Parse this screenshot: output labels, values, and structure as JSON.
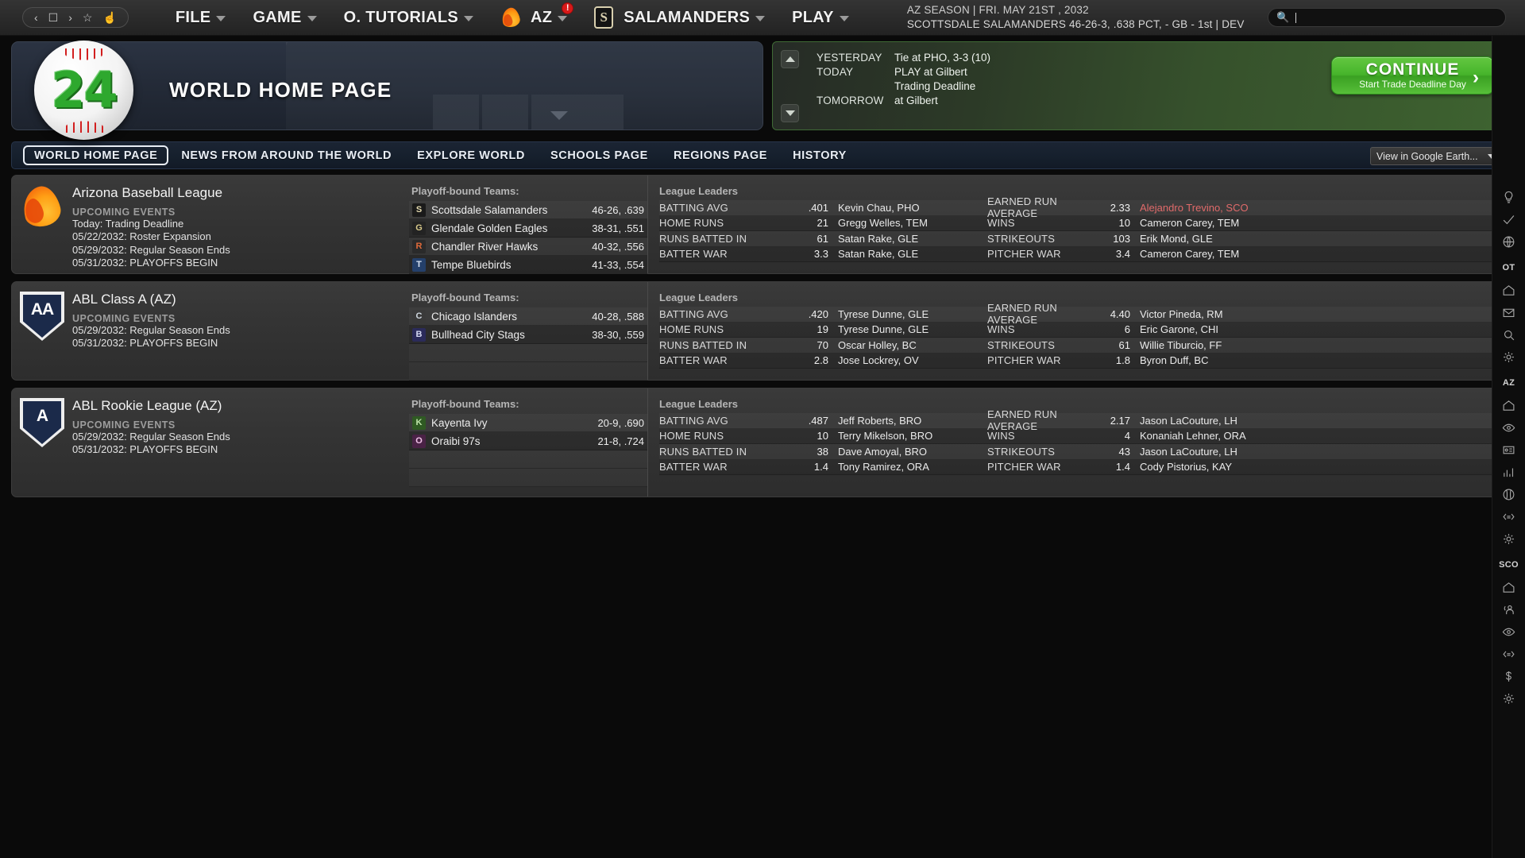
{
  "menubar": {
    "nav_icons": [
      "back-arrow",
      "page",
      "forward-arrow",
      "star",
      "home"
    ],
    "items": [
      {
        "label": "FILE",
        "icon": null,
        "caret": true,
        "badge": null
      },
      {
        "label": "GAME",
        "icon": null,
        "caret": true,
        "badge": null
      },
      {
        "label": "O. TUTORIALS",
        "icon": null,
        "caret": true,
        "badge": null
      },
      {
        "label": "AZ",
        "icon": "flame-icon",
        "caret": true,
        "badge": "!"
      },
      {
        "label": "SALAMANDERS",
        "icon": "salamanders-logo",
        "caret": true,
        "badge": null
      },
      {
        "label": "PLAY",
        "icon": null,
        "caret": true,
        "badge": null
      }
    ],
    "season_line1": "AZ SEASON  |  FRI. MAY 21ST , 2032",
    "season_line2": "SCOTTSDALE SALAMANDERS   46-26-3, .638 PCT, - GB - 1st | DEV",
    "search_placeholder": ""
  },
  "banner": {
    "logo_number": "24",
    "title": "WORLD HOME PAGE"
  },
  "events": {
    "rows": [
      {
        "when": "YESTERDAY",
        "what": "Tie at PHO, 3-3 (10)"
      },
      {
        "when": "TODAY",
        "what": "PLAY at Gilbert"
      },
      {
        "when": "",
        "what": "Trading Deadline"
      },
      {
        "when": "TOMORROW",
        "what": "at Gilbert"
      }
    ],
    "continue_label": "CONTINUE",
    "continue_sub": "Start Trade Deadline Day",
    "continue_arrow": "›",
    "expand_glyph": "»"
  },
  "tabs": [
    {
      "label": "WORLD HOME PAGE",
      "active": true
    },
    {
      "label": "NEWS FROM AROUND THE WORLD",
      "active": false
    },
    {
      "label": "EXPLORE WORLD",
      "active": false
    },
    {
      "label": "SCHOOLS PAGE",
      "active": false
    },
    {
      "label": "REGIONS PAGE",
      "active": false
    },
    {
      "label": "HISTORY",
      "active": false
    }
  ],
  "view_selector": {
    "value": "View in Google Earth..."
  },
  "labels": {
    "upcoming_events": "UPCOMING EVENTS",
    "playoff_bound": "Playoff-bound Teams:",
    "league_leaders": "League Leaders"
  },
  "colors": {
    "accent_green": "#46b42b",
    "hot_red": "#e06a6a",
    "flame_orange": "#ff9f15"
  },
  "leagues": [
    {
      "name": "Arizona Baseball League",
      "logo": "flame",
      "logo_text": "",
      "events": [
        "Today: Trading Deadline",
        "05/22/2032: Roster Expansion",
        "05/29/2032: Regular Season Ends",
        "05/31/2032: PLAYOFFS BEGIN"
      ],
      "teams": [
        {
          "name": "Scottsdale Salamanders",
          "record": "46-26, .639",
          "badge": "S",
          "badge_bg": "#1a1a1a",
          "badge_fg": "#e3d9ae"
        },
        {
          "name": "Glendale Golden Eagles",
          "record": "38-31, .551",
          "badge": "G",
          "badge_bg": "#232323",
          "badge_fg": "#d8c98a"
        },
        {
          "name": "Chandler River Hawks",
          "record": "40-32, .556",
          "badge": "R",
          "badge_bg": "#2a2a2a",
          "badge_fg": "#e06a3a"
        },
        {
          "name": "Tempe Bluebirds",
          "record": "41-33, .554",
          "badge": "T",
          "badge_bg": "#24406b",
          "badge_fg": "#d6e2f2"
        }
      ],
      "leaders_left": [
        {
          "cat": "BATTING AVG",
          "val": ".401",
          "who": "Kevin Chau, PHO"
        },
        {
          "cat": "HOME RUNS",
          "val": "21",
          "who": "Gregg Welles, TEM"
        },
        {
          "cat": "RUNS BATTED IN",
          "val": "61",
          "who": "Satan Rake, GLE"
        },
        {
          "cat": "BATTER WAR",
          "val": "3.3",
          "who": "Satan Rake, GLE"
        }
      ],
      "leaders_right": [
        {
          "cat": "EARNED RUN AVERAGE",
          "val": "2.33",
          "who": "Alejandro Trevino, SCO",
          "hot": true
        },
        {
          "cat": "WINS",
          "val": "10",
          "who": "Cameron Carey, TEM",
          "hot": false
        },
        {
          "cat": "STRIKEOUTS",
          "val": "103",
          "who": "Erik Mond, GLE",
          "hot": false
        },
        {
          "cat": "PITCHER WAR",
          "val": "3.4",
          "who": "Cameron Carey, TEM",
          "hot": false
        }
      ]
    },
    {
      "name": "ABL Class A (AZ)",
      "logo": "shield",
      "logo_text": "AA",
      "events": [
        "05/29/2032: Regular Season Ends",
        "05/31/2032: PLAYOFFS BEGIN"
      ],
      "teams": [
        {
          "name": "Chicago Islanders",
          "record": "40-28, .588",
          "badge": "C",
          "badge_bg": "#3a3a3a",
          "badge_fg": "#cfd7df"
        },
        {
          "name": "Bullhead City Stags",
          "record": "38-30, .559",
          "badge": "B",
          "badge_bg": "#2b2b5a",
          "badge_fg": "#d5d9f2"
        }
      ],
      "leaders_left": [
        {
          "cat": "BATTING AVG",
          "val": ".420",
          "who": "Tyrese Dunne, GLE"
        },
        {
          "cat": "HOME RUNS",
          "val": "19",
          "who": "Tyrese Dunne, GLE"
        },
        {
          "cat": "RUNS BATTED IN",
          "val": "70",
          "who": "Oscar Holley, BC"
        },
        {
          "cat": "BATTER WAR",
          "val": "2.8",
          "who": "Jose Lockrey, OV"
        }
      ],
      "leaders_right": [
        {
          "cat": "EARNED RUN AVERAGE",
          "val": "4.40",
          "who": "Victor Pineda, RM",
          "hot": false
        },
        {
          "cat": "WINS",
          "val": "6",
          "who": "Eric Garone, CHI",
          "hot": false
        },
        {
          "cat": "STRIKEOUTS",
          "val": "61",
          "who": "Willie Tiburcio, FF",
          "hot": false
        },
        {
          "cat": "PITCHER WAR",
          "val": "1.8",
          "who": "Byron Duff, BC",
          "hot": false
        }
      ]
    },
    {
      "name": "ABL Rookie League (AZ)",
      "logo": "shield",
      "logo_text": "A",
      "events": [
        "05/29/2032: Regular Season Ends",
        "05/31/2032: PLAYOFFS BEGIN"
      ],
      "teams": [
        {
          "name": "Kayenta Ivy",
          "record": "20-9, .690",
          "badge": "K",
          "badge_bg": "#2f5a23",
          "badge_fg": "#bde3a8"
        },
        {
          "name": "Oraibi 97s",
          "record": "21-8, .724",
          "badge": "O",
          "badge_bg": "#4a2246",
          "badge_fg": "#f0c2e8"
        }
      ],
      "leaders_left": [
        {
          "cat": "BATTING AVG",
          "val": ".487",
          "who": "Jeff Roberts, BRO"
        },
        {
          "cat": "HOME RUNS",
          "val": "10",
          "who": "Terry Mikelson, BRO"
        },
        {
          "cat": "RUNS BATTED IN",
          "val": "38",
          "who": "Dave Amoyal, BRO"
        },
        {
          "cat": "BATTER WAR",
          "val": "1.4",
          "who": "Tony Ramirez, ORA"
        }
      ],
      "leaders_right": [
        {
          "cat": "EARNED RUN AVERAGE",
          "val": "2.17",
          "who": "Jason LaCouture, LH",
          "hot": false
        },
        {
          "cat": "WINS",
          "val": "4",
          "who": "Konaniah Lehner, ORA",
          "hot": false
        },
        {
          "cat": "STRIKEOUTS",
          "val": "43",
          "who": "Jason LaCouture, LH",
          "hot": false
        },
        {
          "cat": "PITCHER WAR",
          "val": "1.4",
          "who": "Cody Pistorius, KAY",
          "hot": false
        }
      ]
    }
  ],
  "sidebar": {
    "items": [
      {
        "icon": "lightbulb-icon",
        "text": null
      },
      {
        "icon": "check-icon",
        "text": null
      },
      {
        "icon": "globe-icon",
        "text": null
      },
      {
        "icon": null,
        "text": "OT"
      },
      {
        "icon": "home-icon",
        "text": null
      },
      {
        "icon": "mail-icon",
        "text": null
      },
      {
        "icon": "search-icon",
        "text": null
      },
      {
        "icon": "gear-icon",
        "text": null
      },
      {
        "icon": null,
        "text": "AZ"
      },
      {
        "icon": "home-icon",
        "text": null
      },
      {
        "icon": "eye-icon",
        "text": null
      },
      {
        "icon": "card-icon",
        "text": null
      },
      {
        "icon": "chart-icon",
        "text": null
      },
      {
        "icon": "baseball-icon",
        "text": null
      },
      {
        "icon": "trade-icon",
        "text": null
      },
      {
        "icon": "gear-icon",
        "text": null
      },
      {
        "icon": null,
        "text": "SCO"
      },
      {
        "icon": "home-icon",
        "text": null
      },
      {
        "icon": "roster-icon",
        "text": null
      },
      {
        "icon": "eye-icon",
        "text": null
      },
      {
        "icon": "trade-icon",
        "text": null
      },
      {
        "icon": "dollar-icon",
        "text": null
      },
      {
        "icon": "gear-icon",
        "text": null
      }
    ]
  }
}
